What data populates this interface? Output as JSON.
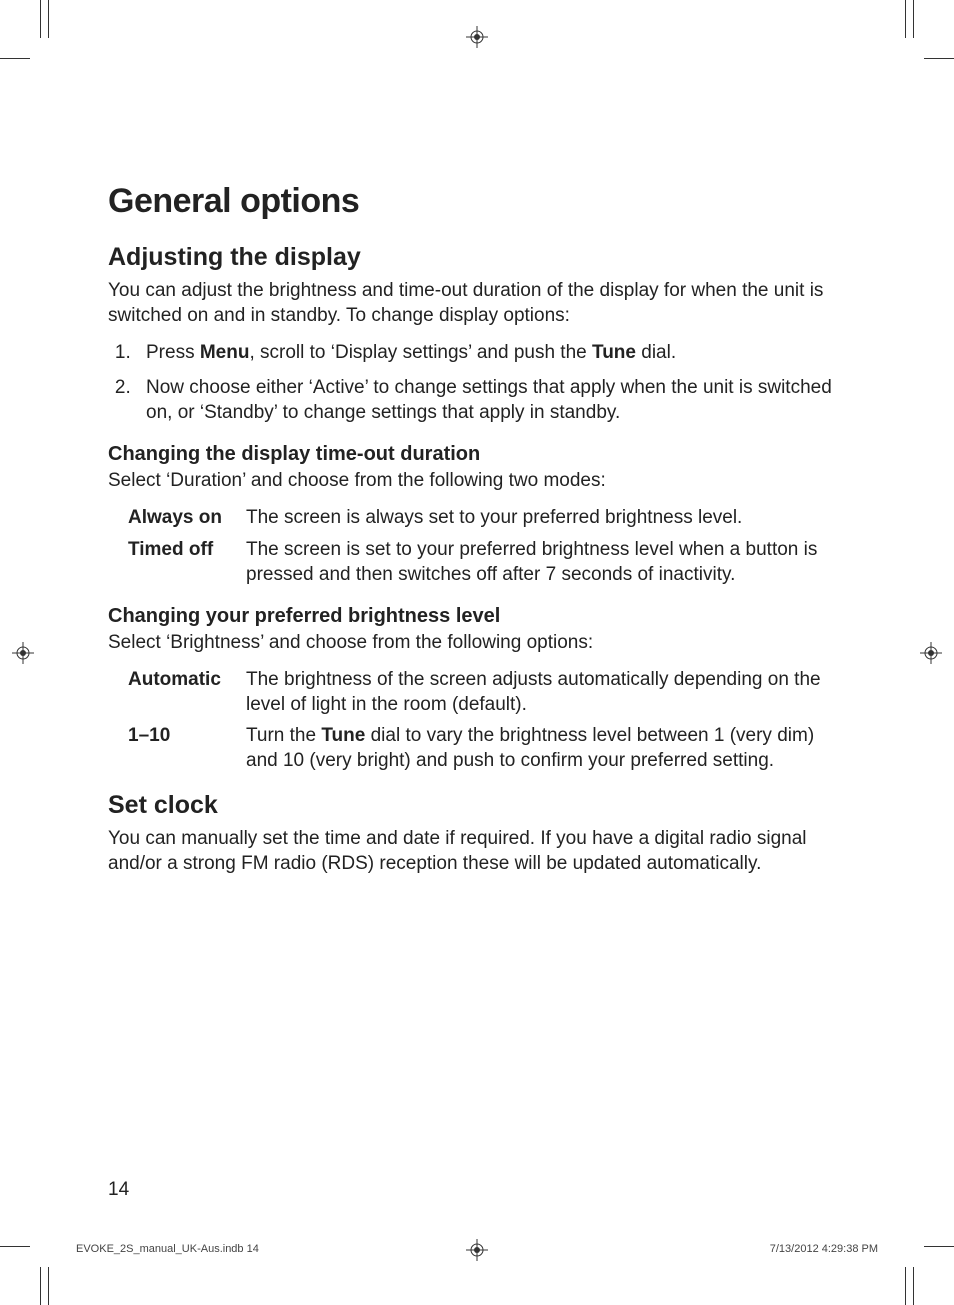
{
  "h1": "General options",
  "section1": {
    "h2": "Adjusting the display",
    "intro": "You can adjust the brightness and time-out duration of the display for when the unit is switched on and in standby. To change display options:",
    "steps": [
      {
        "pre": "Press ",
        "b1": "Menu",
        "mid": ", scroll to ‘Display settings’ and push the ",
        "b2": "Tune",
        "post": " dial."
      },
      {
        "text": "Now choose either ‘Active’ to change settings that apply when the unit is switched on, or ‘Standby’ to change settings that apply in standby."
      }
    ],
    "sub1": {
      "h3": "Changing the display time-out duration",
      "lead": "Select ‘Duration’ and choose from the following two modes:",
      "defs": [
        {
          "term": "Always on",
          "desc": "The screen is always set to your preferred brightness level."
        },
        {
          "term": "Timed off",
          "desc": "The screen is set to your preferred brightness level when a button is pressed and then switches off after 7 seconds of inactivity."
        }
      ]
    },
    "sub2": {
      "h3": "Changing your preferred brightness level",
      "lead": "Select ‘Brightness’ and choose from the following options:",
      "defs": [
        {
          "term": "Automatic",
          "desc": "The brightness of the screen adjusts automatically depending on the level of light in the room (default)."
        },
        {
          "term": "1–10",
          "desc_pre": "Turn the ",
          "desc_b": "Tune",
          "desc_post": " dial to vary the brightness level between 1 (very dim) and 10 (very bright) and push to confirm your preferred setting."
        }
      ]
    }
  },
  "section2": {
    "h2": "Set clock",
    "p": "You can manually set the time and date if required. If you have a digital radio signal and/or a strong FM radio (RDS) reception these will be updated automatically."
  },
  "page_number": "14",
  "footer_file": "EVOKE_2S_manual_UK-Aus.indb   14",
  "footer_date": "7/13/2012   4:29:38 PM"
}
